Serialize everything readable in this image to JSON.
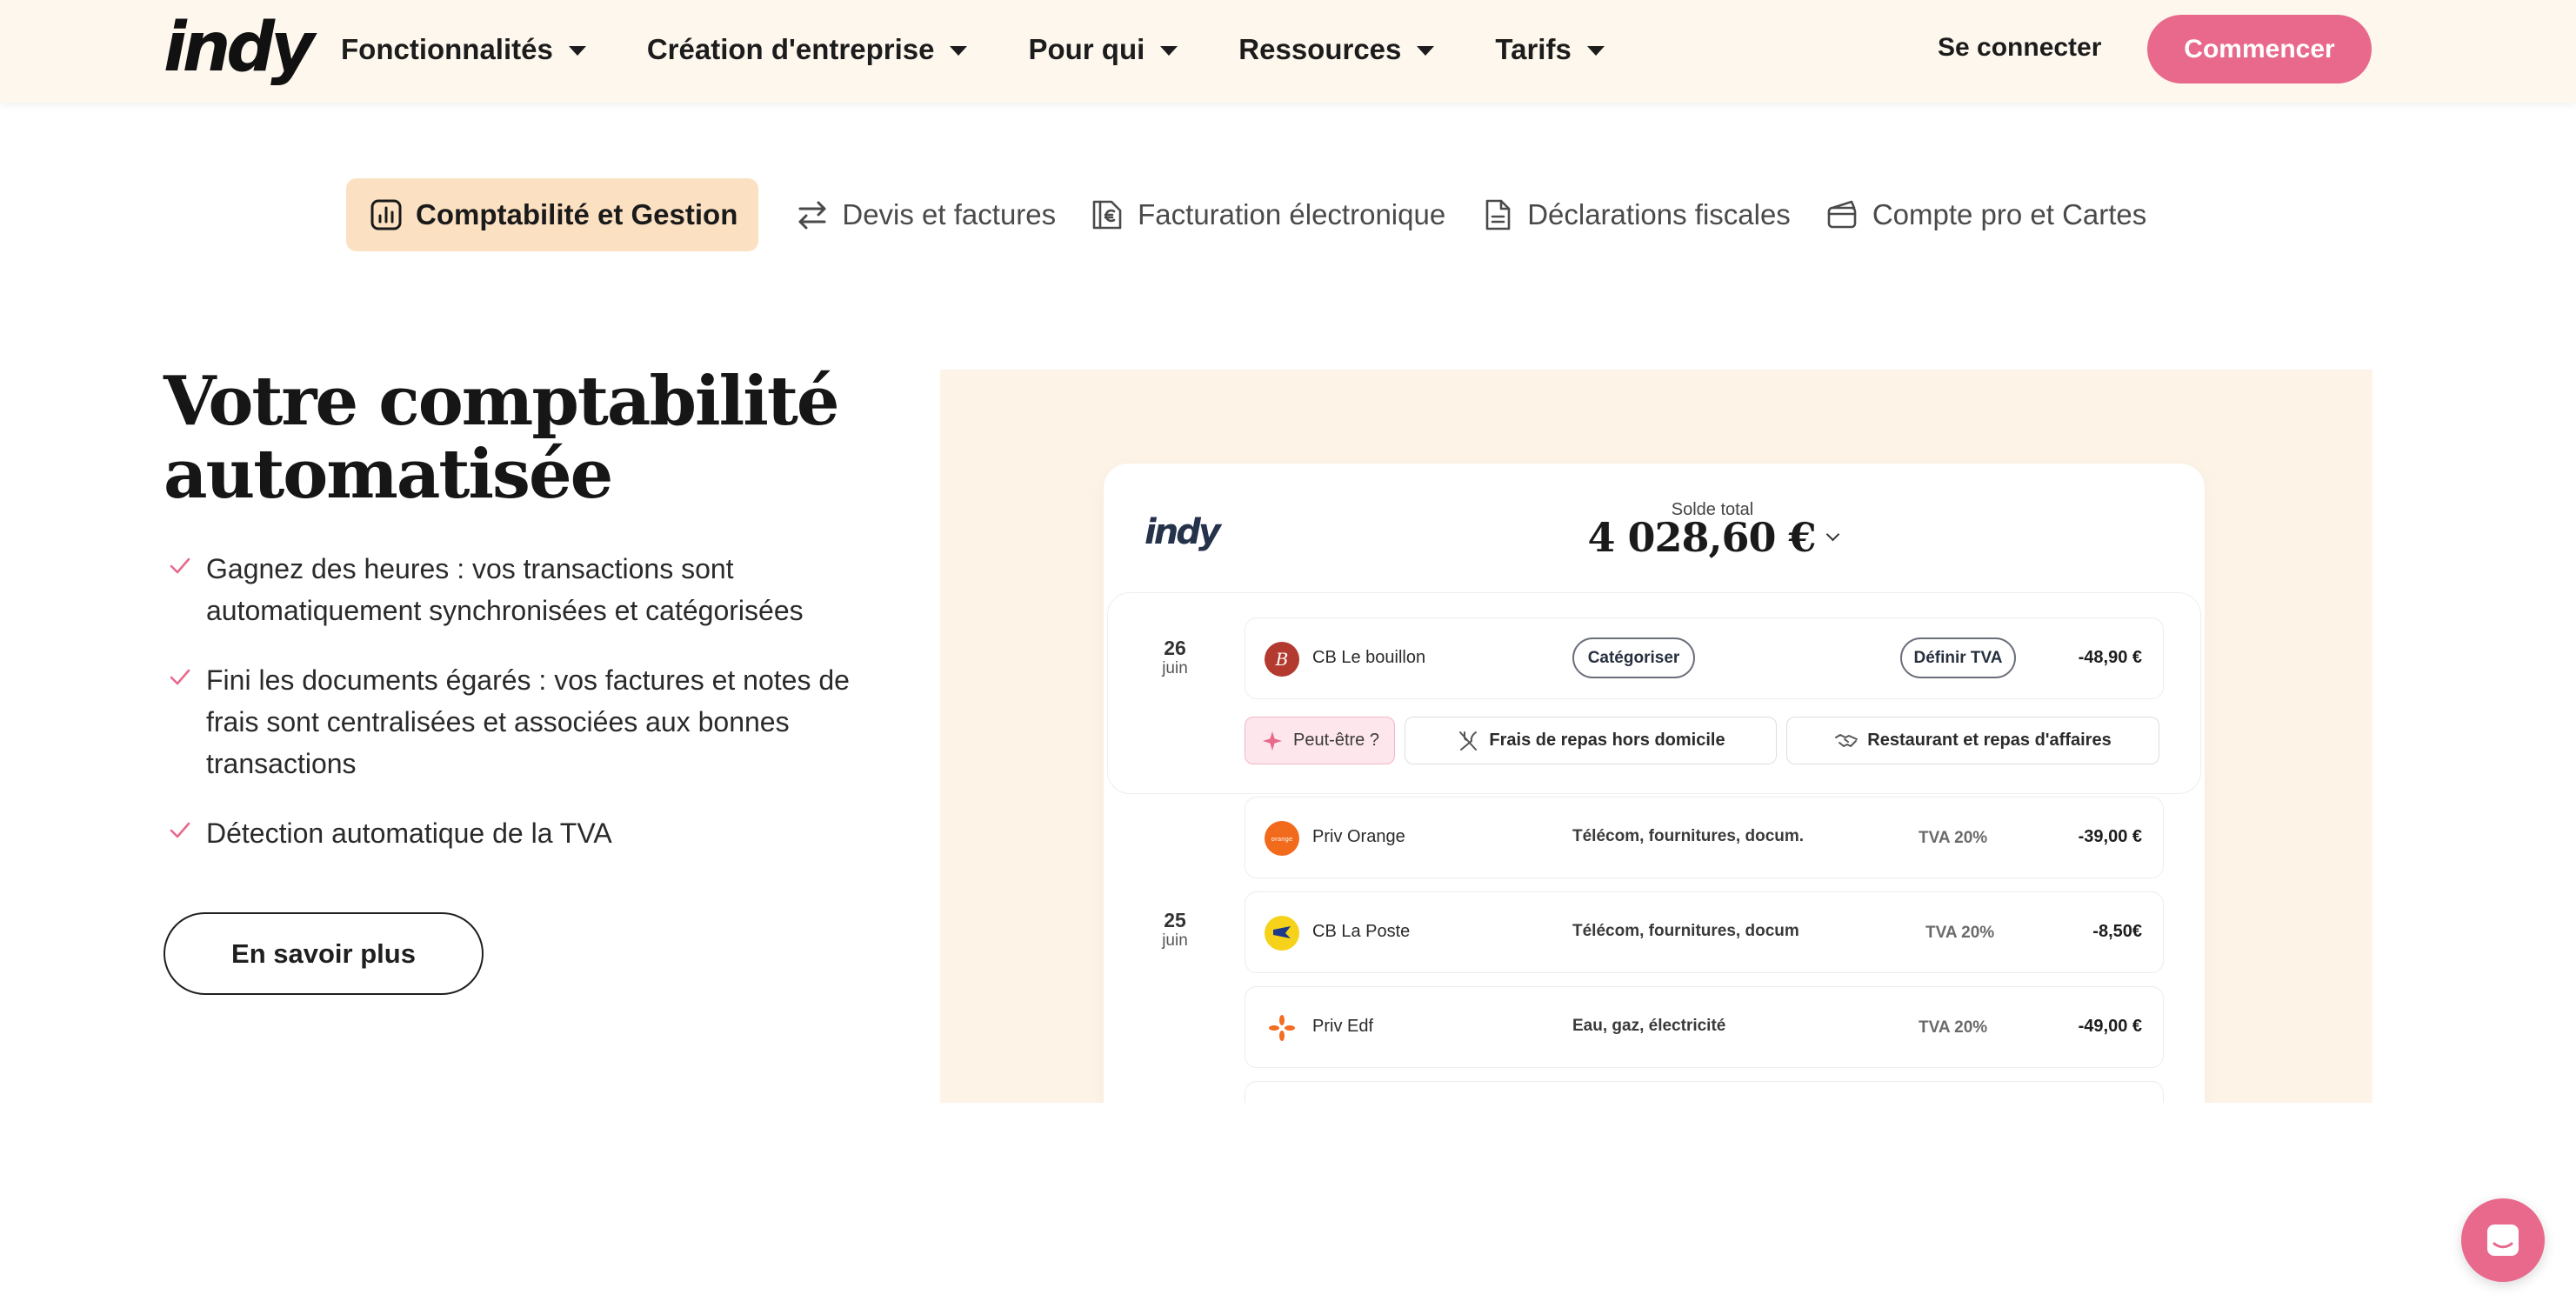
{
  "header": {
    "logo": "indy",
    "nav": [
      {
        "label": "Fonctionnalités"
      },
      {
        "label": "Création d'entreprise"
      },
      {
        "label": "Pour qui"
      },
      {
        "label": "Ressources"
      },
      {
        "label": "Tarifs"
      }
    ],
    "login_label": "Se connecter",
    "cta_label": "Commencer"
  },
  "tabs": [
    {
      "label": "Comptabilité et Gestion",
      "icon": "bar-chart-icon",
      "active": true
    },
    {
      "label": "Devis et factures",
      "icon": "swap-arrows-icon",
      "active": false
    },
    {
      "label": "Facturation électronique",
      "icon": "euro-document-icon",
      "active": false
    },
    {
      "label": "Déclarations fiscales",
      "icon": "document-icon",
      "active": false
    },
    {
      "label": "Compte pro et Cartes",
      "icon": "cards-icon",
      "active": false
    }
  ],
  "content": {
    "title": "Votre comptabilité automatisée",
    "features": [
      "Gagnez des heures : vos transactions sont automatiquement synchronisées et catégorisées",
      "Fini les documents égarés : vos factures et notes de frais sont centralisées et associées aux bonnes transactions",
      "Détection automatique de la TVA"
    ],
    "more_label": "En savoir plus"
  },
  "app": {
    "logo": "indy",
    "balance_label": "Solde total",
    "balance": "4 028,60 €",
    "groups": [
      {
        "day": "26",
        "month": "juin"
      },
      {
        "day": "25",
        "month": "juin"
      }
    ],
    "pending": {
      "name": "CB Le bouillon",
      "categorize_label": "Catégoriser",
      "tva_label": "Définir TVA",
      "amount": "-48,90 €",
      "suggestions": {
        "maybe": "Peut-être ?",
        "option_1": "Frais de repas hors domicile",
        "option_2": "Restaurant et repas d'affaires"
      }
    },
    "transactions": [
      {
        "name": "Priv Orange",
        "category": "Télécom, fournitures, docum.",
        "tva": "TVA 20%",
        "amount": "-39,00 €",
        "icon_color": "#f26a1b"
      },
      {
        "name": "CB La Poste",
        "category": "Télécom, fournitures, docum",
        "tva": "TVA 20%",
        "amount": "-8,50€",
        "icon_color": "#f6d21b"
      },
      {
        "name": "Priv Edf",
        "category": "Eau, gaz, électricité",
        "tva": "TVA 20%",
        "amount": "-49,00 €",
        "icon_color": "#ffffff"
      }
    ]
  },
  "colors": {
    "brand_pink": "#e8698c",
    "header_bg": "#fdf7ee",
    "active_tab_bg": "#fbe1c2",
    "panel_bg": "#fdf4e7"
  }
}
